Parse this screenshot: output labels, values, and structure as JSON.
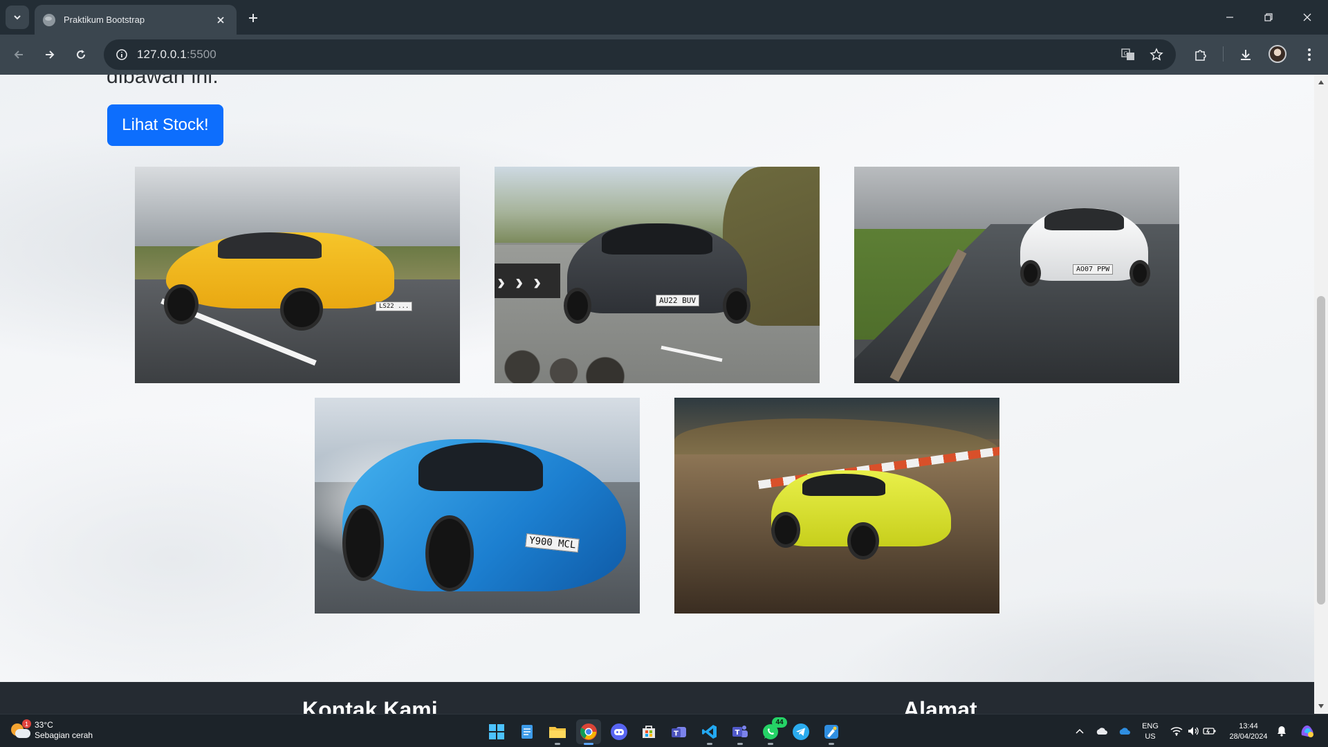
{
  "browser": {
    "tab_title": "Praktikum Bootstrap",
    "url_host": "127.0.0.1",
    "url_port": ":5500"
  },
  "page": {
    "cut_text": "dibawah ini.",
    "button_label": "Lihat Stock!",
    "cars": [
      {
        "color": "#f2b81f",
        "plate": "LS22 ..."
      },
      {
        "color": "#3b3f44",
        "plate": "AU22 BUV"
      },
      {
        "color": "#f4f5f6",
        "plate": "AO07 PPW"
      },
      {
        "color": "#2f9ae6",
        "plate": "Y900 MCL"
      },
      {
        "color": "#d9e12c",
        "plate": ""
      }
    ],
    "footer": {
      "contact_heading": "Kontak Kami",
      "address_heading": "Alamat"
    }
  },
  "taskbar": {
    "weather_temp": "33°C",
    "weather_desc": "Sebagian cerah",
    "weather_badge": "1",
    "whatsapp_badge": "44",
    "lang_line1": "ENG",
    "lang_line2": "US",
    "time": "13:44",
    "date": "28/04/2024"
  },
  "colors": {
    "accent": "#0d6efd",
    "chrome_frame": "#232d35",
    "chrome_toolbar": "#3b464f",
    "footer_bg": "#252b32"
  }
}
